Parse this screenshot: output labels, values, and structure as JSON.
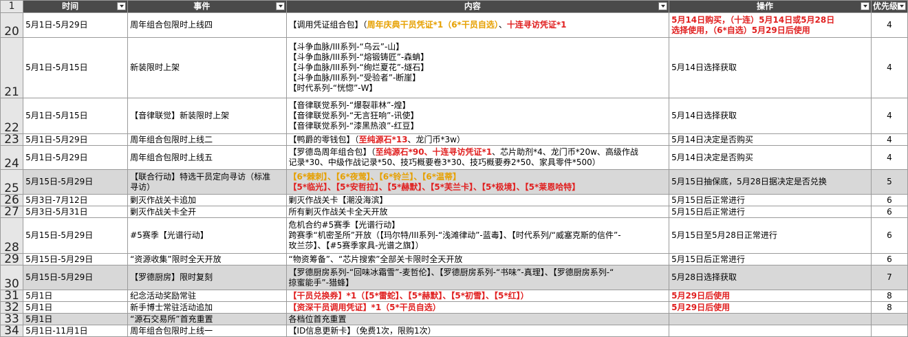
{
  "header": {
    "corner_num": "1",
    "cols": [
      "时间",
      "事件",
      "内容",
      "操作",
      "优先级"
    ]
  },
  "rows": [
    {
      "num": "20",
      "time": "5月1日-5月29日",
      "event": "周年组合包限时上线四",
      "content": [
        [
          {
            "t": "【调用凭证组合包】（",
            "c": ""
          },
          {
            "t": "周年庆典干员凭证*1（6*干员自选）",
            "c": "orange"
          },
          {
            "t": "、",
            "c": ""
          },
          {
            "t": "十连寻访凭证*1",
            "c": "red"
          }
        ]
      ],
      "op": [
        [
          {
            "t": "5月14日购买，（十连）5月14日或5月28日",
            "c": "red"
          }
        ],
        [
          {
            "t": "选择使用，（6*自选）5月29日后使用",
            "c": "red"
          }
        ]
      ],
      "pri": "4"
    },
    {
      "num": "21",
      "time": "5月1日-5月15日",
      "event": "新装限时上架",
      "content": [
        [
          {
            "t": "【斗争血脉/III系列-“乌云”-山】",
            "c": ""
          }
        ],
        [
          {
            "t": "【斗争血脉/III系列-“熔锻铸匠”-森蚺】",
            "c": ""
          }
        ],
        [
          {
            "t": "【斗争血脉/III系列-“绚烂夏花”-燧石】",
            "c": ""
          }
        ],
        [
          {
            "t": "【斗争血脉/III系列-“受验者”-断崖】",
            "c": ""
          }
        ],
        [
          {
            "t": "【时代系列-“恍惚”-W】",
            "c": ""
          }
        ]
      ],
      "op": [
        [
          {
            "t": "5月14日选择获取",
            "c": ""
          }
        ]
      ],
      "pri": "4"
    },
    {
      "num": "22",
      "time": "5月1日-5月15日",
      "event": "【音律联觉】新装限时上架",
      "content": [
        [
          {
            "t": "【音律联觉系列-“爆裂菲林”-煌】",
            "c": ""
          }
        ],
        [
          {
            "t": "【音律联觉系列-“无言狂响”-讯使】",
            "c": ""
          }
        ],
        [
          {
            "t": "【音律联觉系列-“漆黑热浪”-红豆】",
            "c": ""
          }
        ]
      ],
      "op": [
        [
          {
            "t": "5月14日选择获取",
            "c": ""
          }
        ]
      ],
      "pri": "4"
    },
    {
      "num": "23",
      "time": "5月1日-5月29日",
      "event": "周年组合包限时上线二",
      "content": [
        [
          {
            "t": "【鸭爵的零钱包】（",
            "c": ""
          },
          {
            "t": "至纯源石*13",
            "c": "red"
          },
          {
            "t": "、龙门币*3w）",
            "c": ""
          }
        ]
      ],
      "op": [
        [
          {
            "t": "5月14日决定是否购买",
            "c": ""
          }
        ]
      ],
      "pri": "4"
    },
    {
      "num": "24",
      "time": "5月1日-5月29日",
      "event": "周年组合包限时上线五",
      "content": [
        [
          {
            "t": "【罗德岛周年组合包】（",
            "c": ""
          },
          {
            "t": "至纯源石*90、十连寻访凭证*1",
            "c": "red"
          },
          {
            "t": "、芯片助剂*4、龙门币*20w、高级作战",
            "c": ""
          }
        ],
        [
          {
            "t": "记录*30、中级作战记录*50、技巧概要卷3*30、技巧概要券2*50、家具零件*500）",
            "c": ""
          }
        ]
      ],
      "op": [
        [
          {
            "t": "5月14日决定是否购买",
            "c": ""
          }
        ]
      ],
      "pri": "4"
    },
    {
      "num": "25",
      "time": "5月15日-5月29日",
      "event": "【联合行动】特选干员定向寻访（标准寻访）",
      "event_lines": [
        "【联合行动】特选干员定向寻访（标准",
        "寻访）"
      ],
      "content": [
        [
          {
            "t": "【6*棘刺】、【6*夜莺】、【6*铃兰】、【6*温蒂】",
            "c": "orange"
          }
        ],
        [
          {
            "t": "【5*临光】、【5*安哲拉】、【5*赫默】、【5*芙兰卡】、【5*极境】、【5*莱恩哈特】",
            "c": "red"
          }
        ]
      ],
      "op": [
        [
          {
            "t": "5月15日抽保底，5月28日据决定是否兑换",
            "c": ""
          }
        ]
      ],
      "pri": "5",
      "gray": true
    },
    {
      "num": "26",
      "time": "5月3日-7月12日",
      "event": "剿灭作战关卡追加",
      "content": [
        [
          {
            "t": "剿灭作战关卡【潮没海滨】",
            "c": ""
          }
        ]
      ],
      "op": [
        [
          {
            "t": "5月15日后正常进行",
            "c": ""
          }
        ]
      ],
      "pri": "6"
    },
    {
      "num": "27",
      "time": "5月3日-5月31日",
      "event": "剿灭作战关卡全开",
      "content": [
        [
          {
            "t": "所有剿灭作战关卡全天开放",
            "c": ""
          }
        ]
      ],
      "op": [
        [
          {
            "t": "5月15日后正常进行",
            "c": ""
          }
        ]
      ],
      "pri": "6"
    },
    {
      "num": "28",
      "time": "5月15日-5月29日",
      "event": "#5赛季【光谱行动】",
      "content": [
        [
          {
            "t": "危机合约#5赛季【光谱行动】",
            "c": ""
          }
        ],
        [
          {
            "t": "跨赛季“机密圣所”开放（【玛尔特/III系列-“浅滩律动”-蓝毒】、【时代系列/“威塞克斯的信件”-",
            "c": ""
          }
        ],
        [
          {
            "t": "玫兰莎】、【#5赛季家具-光谱之旗】）",
            "c": ""
          }
        ]
      ],
      "op": [
        [
          {
            "t": "5月15日至5月28日正常进行",
            "c": ""
          }
        ]
      ],
      "pri": "6"
    },
    {
      "num": "29",
      "time": "5月15日-5月29日",
      "event": "“资源收集”限时全天开放",
      "content": [
        [
          {
            "t": "“物资筹备”、“芯片搜索”全部关卡限时全天开放",
            "c": ""
          }
        ]
      ],
      "op": [
        [
          {
            "t": "5月15日后正常进行",
            "c": ""
          }
        ]
      ],
      "pri": "6"
    },
    {
      "num": "30",
      "time": "5月15日-5月29日",
      "event": "【罗德厨房】限时复刻",
      "content": [
        [
          {
            "t": "【罗德厨房系列-“回味冰霜雪”-麦哲伦】、【罗德厨房系列-“书味”-真理】、【罗德厨房系列-“",
            "c": ""
          }
        ],
        [
          {
            "t": "掠蜜能手”-猎蜂】",
            "c": ""
          }
        ]
      ],
      "op": [
        [
          {
            "t": "5月28日选择获取",
            "c": ""
          }
        ]
      ],
      "pri": "7",
      "gray": true
    },
    {
      "num": "31",
      "time": "5月1日",
      "event": "纪念活动奖励常驻",
      "content": [
        [
          {
            "t": "【干员兑换券】*1（【5*雷蛇】、【5*赫默】、【5*初雪】、【5*红】）",
            "c": "red"
          }
        ]
      ],
      "op": [
        [
          {
            "t": "5月29日后使用",
            "c": "red"
          }
        ]
      ],
      "pri": "8"
    },
    {
      "num": "32",
      "time": "5月1日",
      "event": "新手博士常驻活动追加",
      "content": [
        [
          {
            "t": "【资深干员调用凭证】*1（5*干员自选）",
            "c": "red"
          }
        ]
      ],
      "op": [
        [
          {
            "t": "5月29日后使用",
            "c": "red"
          }
        ]
      ],
      "pri": "8"
    },
    {
      "num": "33",
      "time": "5月1日",
      "event": "“源石交易所”首充重置",
      "content": [
        [
          {
            "t": "各档位首充重置",
            "c": ""
          }
        ]
      ],
      "op": [
        [
          {
            "t": "",
            "c": ""
          }
        ]
      ],
      "pri": "",
      "gray": true
    },
    {
      "num": "34",
      "time": "5月1日-11月1日",
      "event": "周年组合包限时上线一",
      "content": [
        [
          {
            "t": "【ID信息更新卡】（免费1次，限购1次）",
            "c": ""
          }
        ]
      ],
      "op": [
        [
          {
            "t": "",
            "c": ""
          }
        ]
      ],
      "pri": ""
    }
  ],
  "colors": {
    "header_bg": "#4a4a4a",
    "row_gray": "#d8d8d8",
    "red": "#e02020",
    "orange": "#e6a000"
  }
}
